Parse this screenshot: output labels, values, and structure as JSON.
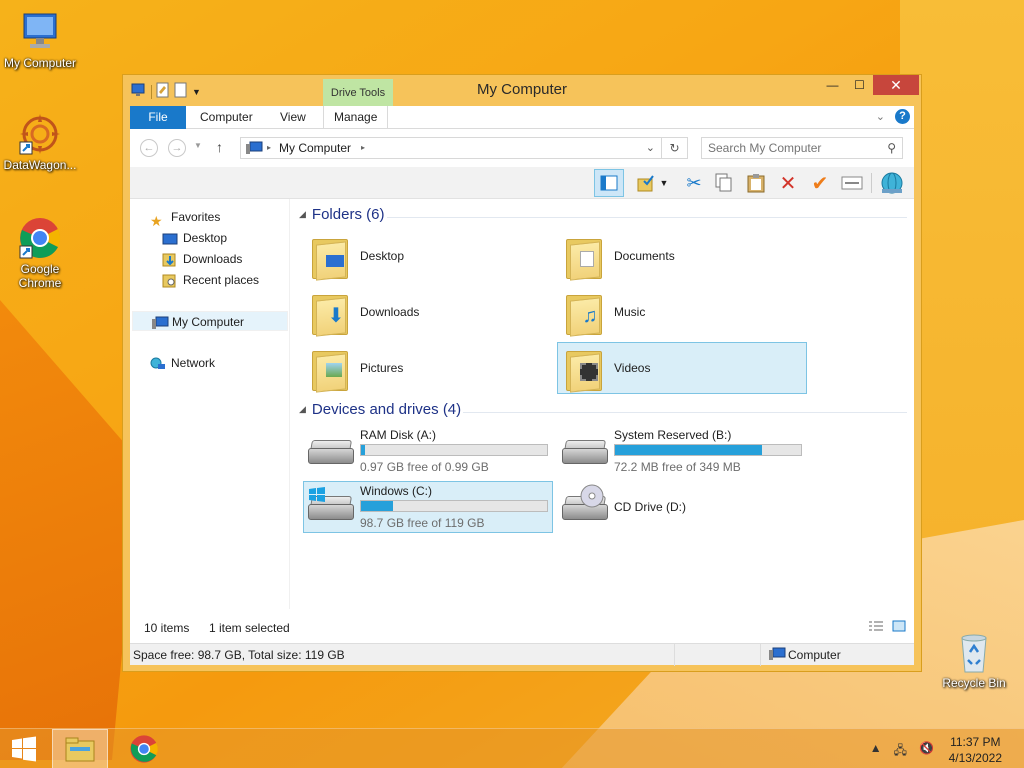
{
  "desktop": {
    "icons": [
      {
        "label": "My Computer"
      },
      {
        "label": "DataWagon..."
      },
      {
        "label": "Google Chrome"
      },
      {
        "label": "Recycle Bin"
      }
    ]
  },
  "window": {
    "title": "My Computer",
    "contextual_tab_group": "Drive Tools",
    "controls": {
      "minimize": "—",
      "maximize": "☐",
      "close": "✕"
    }
  },
  "ribbon": {
    "tabs": [
      {
        "label": "File"
      },
      {
        "label": "Computer"
      },
      {
        "label": "View"
      },
      {
        "label": "Manage"
      }
    ],
    "help": "?"
  },
  "address_bar": {
    "path": "My Computer",
    "search_placeholder": "Search My Computer"
  },
  "nav_pane": {
    "favorites": {
      "label": "Favorites",
      "items": [
        {
          "label": "Desktop"
        },
        {
          "label": "Downloads"
        },
        {
          "label": "Recent places"
        }
      ]
    },
    "computer": {
      "label": "My Computer"
    },
    "network": {
      "label": "Network"
    }
  },
  "groups": {
    "folders": {
      "title": "Folders (6)",
      "items": [
        {
          "label": "Desktop",
          "icon": "desktop-icon"
        },
        {
          "label": "Documents",
          "icon": "documents-icon"
        },
        {
          "label": "Downloads",
          "icon": "download-arrow-icon"
        },
        {
          "label": "Music",
          "icon": "music-note-icon"
        },
        {
          "label": "Pictures",
          "icon": "picture-icon"
        },
        {
          "label": "Videos",
          "icon": "film-icon"
        }
      ]
    },
    "drives": {
      "title": "Devices and drives (4)",
      "items": [
        {
          "label": "RAM Disk (A:)",
          "free": "0.97 GB free of 0.99 GB",
          "used_fraction": 0.02
        },
        {
          "label": "System Reserved (B:)",
          "free": "72.2 MB free of 349 MB",
          "used_fraction": 0.79
        },
        {
          "label": "Windows (C:)",
          "free": "98.7 GB free of 119 GB",
          "used_fraction": 0.17
        },
        {
          "label": "CD Drive (D:)"
        }
      ]
    }
  },
  "status": {
    "items_count": "10 items",
    "selected": "1 item selected",
    "space": "Space free: 98.7 GB, Total size: 119 GB",
    "location": "Computer"
  },
  "taskbar": {
    "time": "11:37 PM",
    "date": "4/13/2022"
  },
  "colors": {
    "accent": "#1979ca",
    "drive_bar": "#26a0da",
    "selection": "#d9eef8"
  }
}
